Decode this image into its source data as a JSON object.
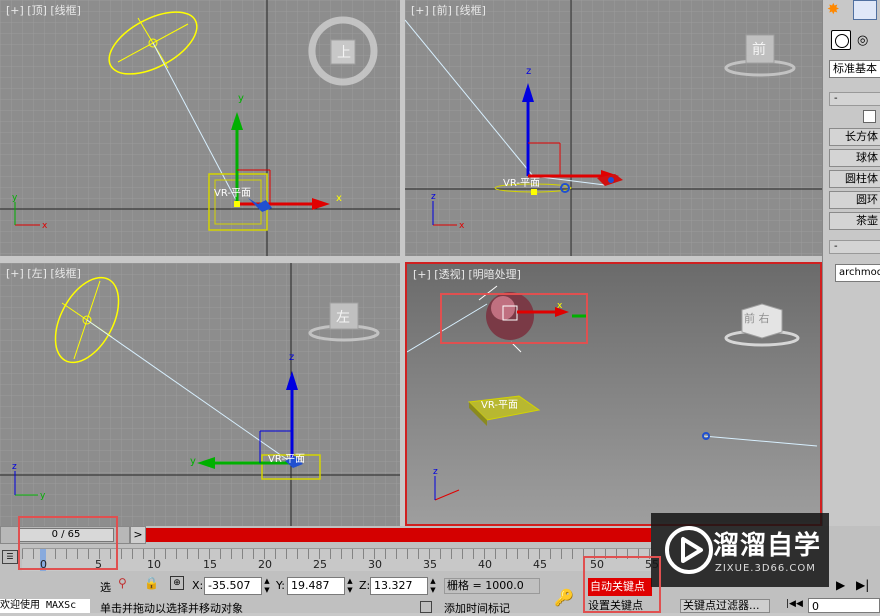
{
  "viewports": {
    "top": {
      "label": "[+] [顶] [线框]",
      "object_label": "VR-平面",
      "cube_text": "上"
    },
    "front": {
      "label": "[+] [前] [线框]",
      "object_label": "VR-平面",
      "cube_text": "前"
    },
    "left": {
      "label": "[+] [左] [线框]",
      "object_label": "VR-平面",
      "cube_text": "左"
    },
    "perspective": {
      "label": "[+] [透视] [明暗处理]",
      "object_label": "VR-平面",
      "cube_text": "前 右"
    }
  },
  "axes": {
    "x": "x",
    "y": "y",
    "z": "z"
  },
  "command_panel": {
    "dropdown": "标准基本",
    "rollout_sign": "-",
    "buttons": [
      "长方体",
      "球体",
      "圆柱体",
      "圆环",
      "茶壶"
    ],
    "rollout2_sign": "-",
    "name_field": "archmode"
  },
  "timeline": {
    "frame_counter": "0 / 65",
    "next_button": ">",
    "ticks": [
      "0",
      "5",
      "10",
      "15",
      "20",
      "25",
      "30",
      "35",
      "40",
      "45",
      "50",
      "55"
    ]
  },
  "status": {
    "x_label": "X:",
    "x_value": "-35.507",
    "y_label": "Y:",
    "y_value": "19.487",
    "z_label": "Z:",
    "z_value": "13.327",
    "grid": "栅格 = 1000.0",
    "auto_key": "自动关键点",
    "set_key": "设置关键点",
    "key_filters": "关键点过滤器...",
    "add_time_tag": "添加时间标记",
    "prompt": "单击并拖动以选择并移动对象",
    "maxscript": "欢迎使用 MAXSc",
    "select_label": "选",
    "frame_value": "0"
  },
  "watermark": {
    "title": "溜溜自学",
    "url": "ZIXUE.3D66.COM"
  },
  "colors": {
    "highlight": "#e05050",
    "axis_x": "#e00000",
    "axis_y": "#00b000",
    "axis_z": "#0000e0",
    "light": "#ffff00",
    "timeline_red": "#d40000"
  }
}
